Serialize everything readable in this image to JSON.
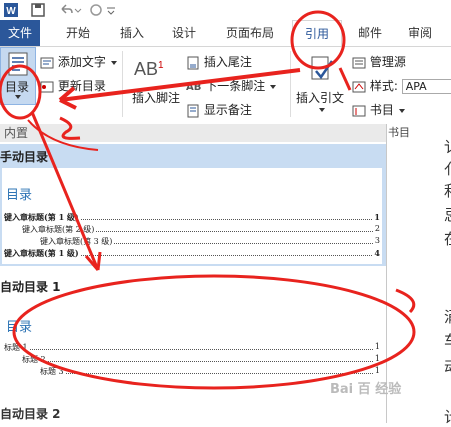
{
  "tabs": [
    "文件",
    "开始",
    "插入",
    "设计",
    "页面布局",
    "引用",
    "邮件",
    "审阅"
  ],
  "ribbon": {
    "toc_button": "目录",
    "add_text": "添加文字",
    "update_toc": "更新目录",
    "insert_footnote": "插入脚注",
    "ab_icon": "AB",
    "ab_sup": "1",
    "ab_next_icon": "AB",
    "insert_endnote": "插入尾注",
    "next_footnote": "下一条脚注",
    "show_notes": "显示备注",
    "insert_citation": "插入引文",
    "manage_sources": "管理源",
    "style_label": "样式:",
    "style_value": "APA",
    "bibliography": "书目",
    "group_label": "书目"
  },
  "panel": {
    "builtin": "内置",
    "manual_toc": "手动目录",
    "manual_preview": {
      "title": "目录",
      "lines": [
        {
          "text": "键入章标题(第 1 级)",
          "page": "1"
        },
        {
          "text": "键入章标题(第 2 级)",
          "page": "2"
        },
        {
          "text": "键入章标题(第 3 级)",
          "page": "3"
        },
        {
          "text": "键入章标题(第 1 级)",
          "page": "4"
        }
      ]
    },
    "auto1": "自动目录 1",
    "auto1_preview": {
      "title": "目录",
      "lines": [
        {
          "text": "标题 1",
          "page": "1"
        },
        {
          "text": "标题 2",
          "page": "1"
        },
        {
          "text": "标题 3",
          "page": "1"
        }
      ]
    },
    "auto2": "自动目录 2"
  },
  "doc_chars": [
    "讠",
    "亻",
    "利",
    "忌",
    "在",
    "涌",
    "车",
    "动",
    "计"
  ],
  "watermark": "Bai 百 经验",
  "colors": {
    "accent": "#2b579a",
    "annotation": "#e8231e",
    "selection": "#c8dcf2"
  }
}
